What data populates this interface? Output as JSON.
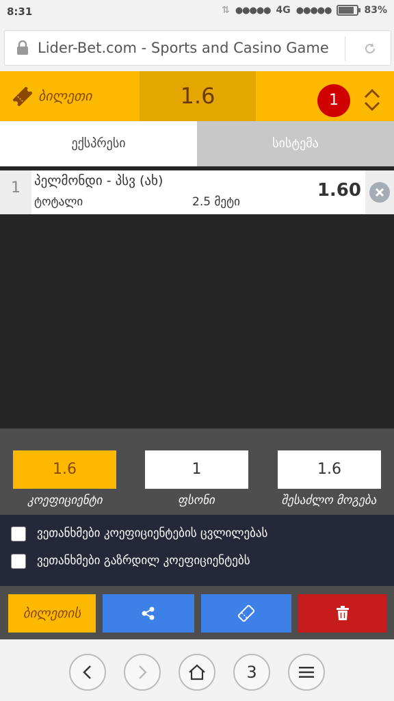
{
  "status": {
    "time": "8:31",
    "network": "4G",
    "battery": "83%",
    "battery_level": 0.83
  },
  "browser": {
    "url": "Lider-Bet.com - Sports and Casino Game",
    "tabs_count": "3"
  },
  "header": {
    "ticket_label": "ბილეთი",
    "total_odds": "1.6",
    "bet_count": "1"
  },
  "tabs": {
    "express": "ექსპრესი",
    "system": "სისტემა"
  },
  "bets": [
    {
      "index": "1",
      "match": "პელმონდი - პსვ (ახ)",
      "market": "ტოტალი",
      "param": "2.5 მეტი",
      "odd": "1.60"
    }
  ],
  "summary": {
    "coef_value": "1.6",
    "coef_label": "კოეფიციენტი",
    "stake_value": "1",
    "stake_label": "ფსონი",
    "win_value": "1.6",
    "win_label": "შესაძლო მოგება"
  },
  "options": {
    "accept_odds_changes": "ვეთანხმები კოეფიციენტების ცვლილებას",
    "accept_increased_odds": "ვეთანხმები გაზრდილ კოეფიციენტებს"
  },
  "actions": {
    "tickets_label": "ბილეთის"
  },
  "colors": {
    "accent": "#fcb900",
    "accent_dark": "#e4a600",
    "blue": "#3d80e8",
    "red": "#c71c1c",
    "badge": "#d10000"
  }
}
